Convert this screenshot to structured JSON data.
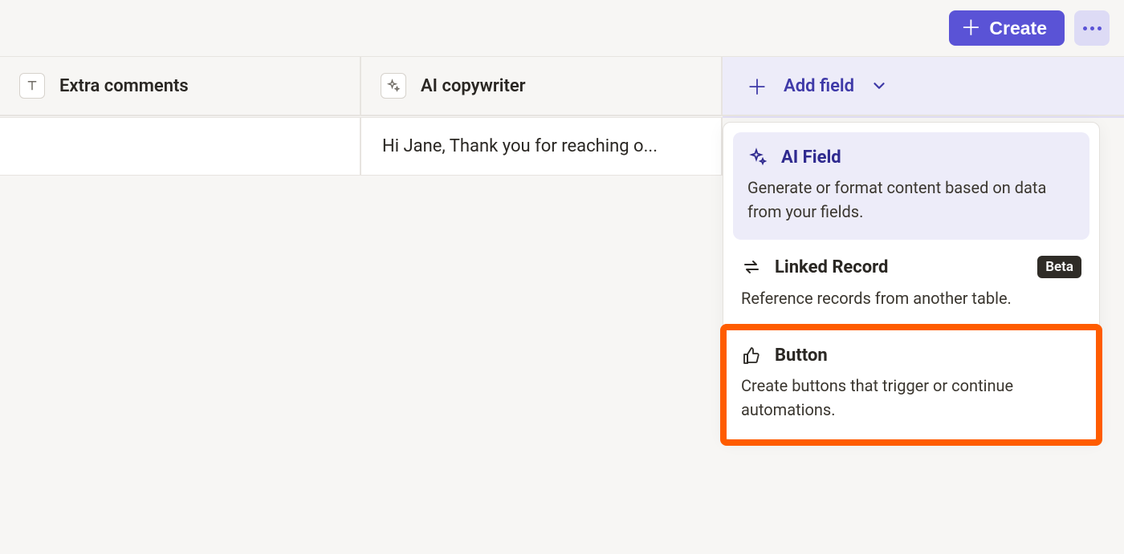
{
  "topbar": {
    "create_label": "Create"
  },
  "columns": {
    "col1_label": "Extra comments",
    "col2_label": "AI copywriter",
    "add_field_label": "Add field"
  },
  "row1": {
    "cell1": "",
    "cell2": "Hi Jane, Thank you for reaching o..."
  },
  "dropdown": {
    "item0": {
      "title": "AI Field",
      "desc": "Generate or format content based on data from your fields."
    },
    "item1": {
      "title": "Linked Record",
      "desc": "Reference records from another table.",
      "badge": "Beta"
    },
    "item2": {
      "title": "Button",
      "desc": "Create buttons that trigger or continue automations."
    }
  }
}
